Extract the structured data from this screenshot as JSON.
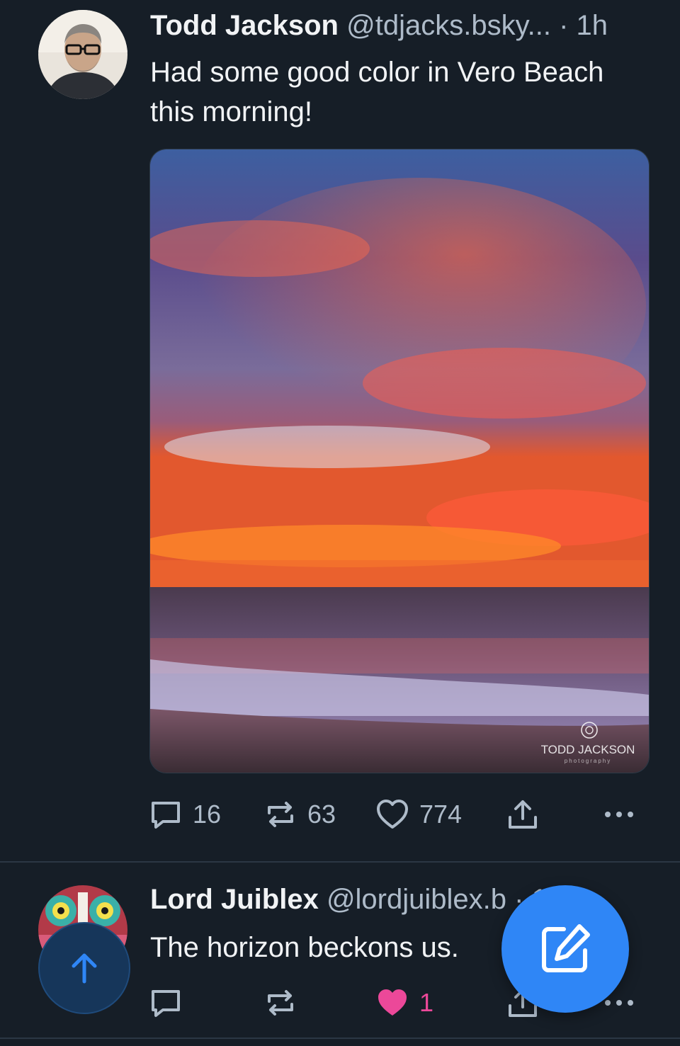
{
  "posts": [
    {
      "author_name": "Todd Jackson",
      "handle": "@tdjacks.bsky...",
      "separator": "·",
      "time": "1h",
      "text": "Had some good color in Vero Beach this morning!",
      "image_watermark": "TODD JACKSON",
      "image_watermark_sub": "photography",
      "replies": "16",
      "reposts": "63",
      "likes": "774",
      "liked": false
    },
    {
      "author_name": "Lord Juiblex",
      "handle": "@lordjuiblex.b",
      "separator": "·",
      "time": "13m",
      "text": "The horizon beckons us.",
      "replies": "",
      "reposts": "",
      "likes": "1",
      "liked": true
    }
  ],
  "colors": {
    "background": "#161e27",
    "accent": "#2f86f6",
    "like_active": "#ec4899",
    "muted": "#aebbc9"
  }
}
